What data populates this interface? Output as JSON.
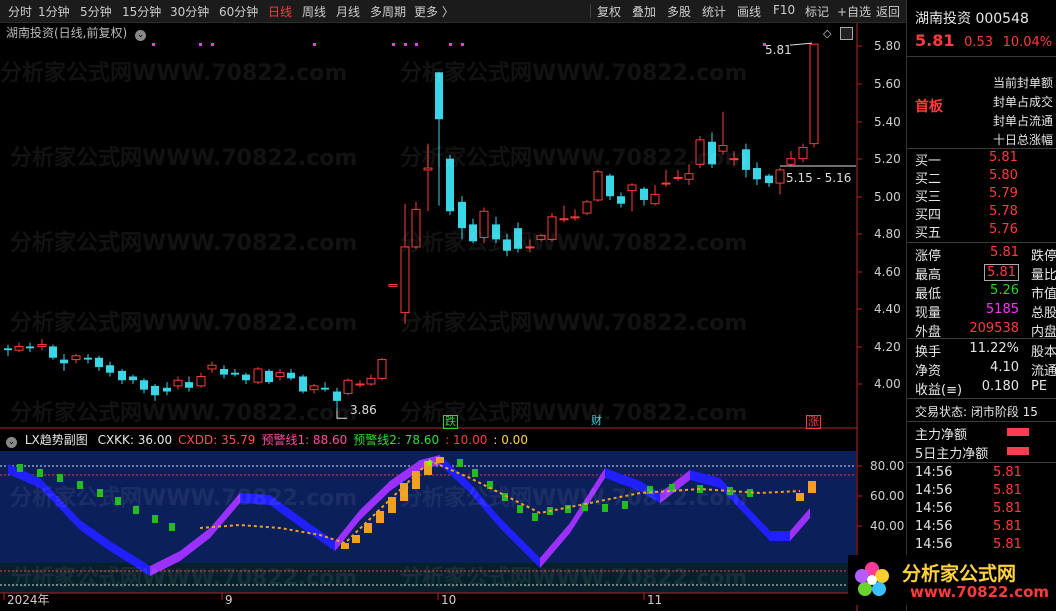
{
  "toolbar": {
    "periods": [
      "分时",
      "1分钟",
      "5分钟",
      "15分钟",
      "30分钟",
      "60分钟",
      "日线",
      "周线",
      "月线",
      "多周期",
      "更多 〉"
    ],
    "active_period": "日线",
    "actions": [
      "复权",
      "叠加",
      "多股",
      "统计",
      "画线",
      "F10",
      "标记",
      "+自选",
      "返回"
    ]
  },
  "chart": {
    "title": "湖南投资(日线,前复权)",
    "price_labels": [
      "5.80",
      "5.60",
      "5.40",
      "5.20",
      "5.00",
      "4.80",
      "4.60",
      "4.40",
      "4.20",
      "4.00"
    ],
    "high_annotation": "5.81",
    "low_annotation": "3.86",
    "range_annotation": "5.15 - 5.16",
    "event_marks": [
      "跌",
      "财",
      "涨"
    ],
    "date_labels": [
      "2024年",
      "9",
      "10",
      "11"
    ]
  },
  "indicator": {
    "name": "LX趋势副图",
    "values": [
      {
        "label": "CXKK: 36.00",
        "color": "#e6e6e6"
      },
      {
        "label": "CXDD: 35.79",
        "color": "#ff5050"
      },
      {
        "label": "预警线1: 88.60",
        "color": "#ff4fa0"
      },
      {
        "label": "预警线2: 78.60",
        "color": "#33dd33"
      },
      {
        "label": ": 10.00",
        "color": "#ff3b3b"
      },
      {
        "label": ": 0.00",
        "color": "#ffd23f"
      }
    ],
    "axis_labels": [
      "80.00",
      "60.00",
      "40.00"
    ]
  },
  "right_panel": {
    "stock_name": "湖南投资",
    "stock_code": "000548",
    "price": "5.81",
    "change": "0.53",
    "change_pct": "10.04%",
    "badge": "首板",
    "notes": [
      "当前封单额",
      "封单占成交",
      "封单占流通",
      "十日总涨幅"
    ],
    "order_book": [
      {
        "label": "买一",
        "price": "5.81"
      },
      {
        "label": "买二",
        "price": "5.80"
      },
      {
        "label": "买三",
        "price": "5.79"
      },
      {
        "label": "买四",
        "price": "5.78"
      },
      {
        "label": "买五",
        "price": "5.76"
      }
    ],
    "stats": [
      {
        "label": "涨停",
        "value": "5.81",
        "color": "red",
        "extra": "跌停"
      },
      {
        "label": "最高",
        "value": "5.81",
        "color": "red",
        "extra": "量比"
      },
      {
        "label": "最低",
        "value": "5.26",
        "color": "green",
        "extra": "市值"
      },
      {
        "label": "现量",
        "value": "5185",
        "color": "mag",
        "extra": "总股"
      },
      {
        "label": "外盘",
        "value": "209538",
        "color": "red",
        "extra": "内盘"
      }
    ],
    "stats2": [
      {
        "label": "换手",
        "value": "11.22%",
        "extra": "股本"
      },
      {
        "label": "净资",
        "value": "4.10",
        "extra": "流通"
      },
      {
        "label": "收益(≡)",
        "value": "0.180",
        "extra": "PE"
      }
    ],
    "trade_status": "交易状态: 闭市阶段 15",
    "fund_flow": [
      {
        "label": "主力净额"
      },
      {
        "label": "5日主力净额"
      }
    ],
    "ticks": [
      {
        "time": "14:56",
        "price": "5.81"
      },
      {
        "time": "14:56",
        "price": "5.81"
      },
      {
        "time": "14:56",
        "price": "5.81"
      },
      {
        "time": "14:56",
        "price": "5.81"
      },
      {
        "time": "14:56",
        "price": "5.81"
      }
    ]
  },
  "watermark": "分析家公式网WWW.70822.com",
  "logo": {
    "text": "分析家公式网",
    "url": "www.70822.com"
  },
  "colors": {
    "up": "#ff3b3b",
    "down": "#38d6e6",
    "bg": "#000000",
    "indicator_bg": "#0b1f5a"
  }
}
